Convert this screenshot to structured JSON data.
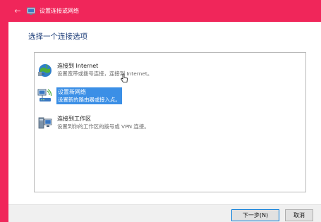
{
  "window": {
    "title": "设置连接或网络",
    "back_icon": "←"
  },
  "heading": "选择一个连接选项",
  "options": [
    {
      "name": "连接到 Internet",
      "description": "设置宽带或拨号连接，连接到 Internet。",
      "icon": "globe-network-icon",
      "selected": false
    },
    {
      "name": "设置新网络",
      "description": "设置新的路由器或接入点。",
      "icon": "router-network-icon",
      "selected": true
    },
    {
      "name": "连接到工作区",
      "description": "设置到你的工作区的拨号或 VPN 连接。",
      "icon": "workplace-computer-icon",
      "selected": false
    }
  ],
  "buttons": {
    "next": "下一步(N)",
    "cancel": "取消"
  },
  "colors": {
    "accent": "#f0265a",
    "selection": "#3b8fe6",
    "heading": "#1f3f7a"
  }
}
